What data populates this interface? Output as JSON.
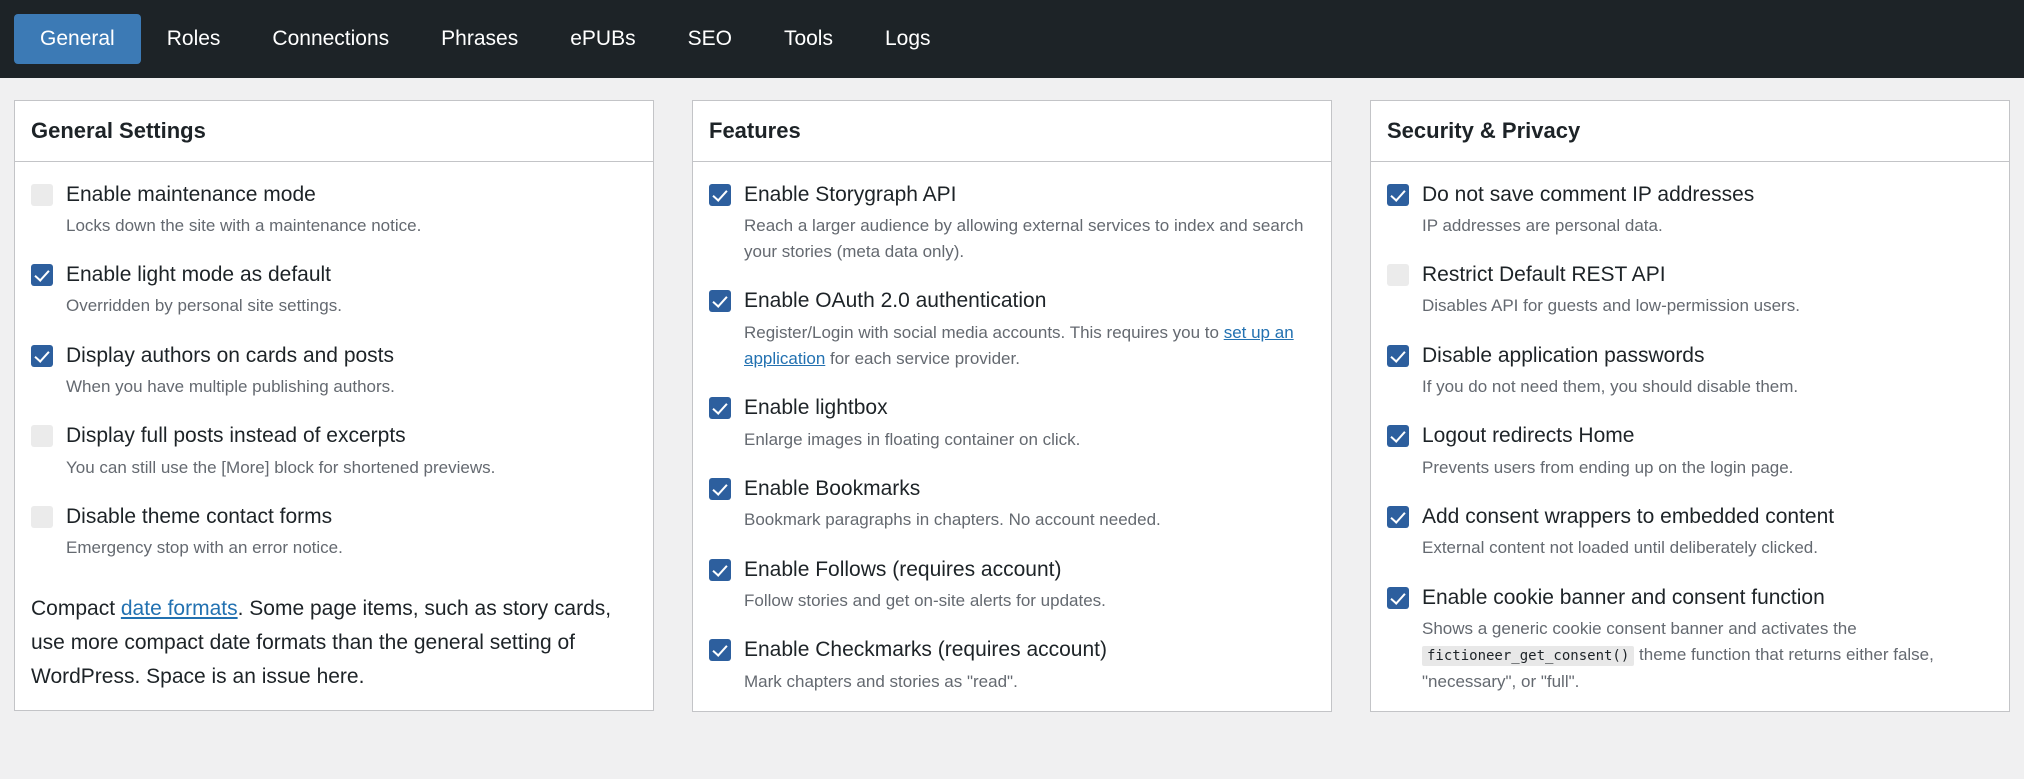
{
  "tabs": [
    {
      "label": "General",
      "active": true
    },
    {
      "label": "Roles",
      "active": false
    },
    {
      "label": "Connections",
      "active": false
    },
    {
      "label": "Phrases",
      "active": false
    },
    {
      "label": "ePUBs",
      "active": false
    },
    {
      "label": "SEO",
      "active": false
    },
    {
      "label": "Tools",
      "active": false
    },
    {
      "label": "Logs",
      "active": false
    }
  ],
  "colors": {
    "header_bg": "#1d2327",
    "active_tab_bg": "#3c7ab5",
    "page_bg": "#f0f0f1",
    "card_border": "#c3c4c7",
    "checkbox_checked": "#2d5f9e",
    "checkbox_unchecked": "#ebebeb",
    "link": "#2271b1",
    "description_text": "#646970"
  },
  "columns": [
    {
      "title": "General Settings",
      "items": [
        {
          "checked": false,
          "label": "Enable maintenance mode",
          "desc": "Locks down the site with a maintenance notice."
        },
        {
          "checked": true,
          "label": "Enable light mode as default",
          "desc": "Overridden by personal site settings."
        },
        {
          "checked": true,
          "label": "Display authors on cards and posts",
          "desc": "When you have multiple publishing authors."
        },
        {
          "checked": false,
          "label": "Display full posts instead of excerpts",
          "desc": "You can still use the [More] block for shortened previews."
        },
        {
          "checked": false,
          "label": "Disable theme contact forms",
          "desc": "Emergency stop with an error notice."
        }
      ],
      "note": {
        "before": "Compact ",
        "link": "date formats",
        "after": ". Some page items, such as story cards, use more compact date formats than the general setting of WordPress. Space is an issue here."
      }
    },
    {
      "title": "Features",
      "items": [
        {
          "checked": true,
          "label": "Enable Storygraph API",
          "desc": "Reach a larger audience by allowing external services to index and search your stories (meta data only)."
        },
        {
          "checked": true,
          "label": "Enable OAuth 2.0 authentication",
          "desc_before": "Register/Login with social media accounts. This requires you to ",
          "desc_link": "set up an application",
          "desc_after": " for each service provider."
        },
        {
          "checked": true,
          "label": "Enable lightbox",
          "desc": "Enlarge images in floating container on click."
        },
        {
          "checked": true,
          "label": "Enable Bookmarks",
          "desc": "Bookmark paragraphs in chapters. No account needed."
        },
        {
          "checked": true,
          "label": "Enable Follows (requires account)",
          "desc": "Follow stories and get on-site alerts for updates."
        },
        {
          "checked": true,
          "label": "Enable Checkmarks (requires account)",
          "desc": "Mark chapters and stories as \"read\"."
        }
      ]
    },
    {
      "title": "Security & Privacy",
      "items": [
        {
          "checked": true,
          "label": "Do not save comment IP addresses",
          "desc": "IP addresses are personal data."
        },
        {
          "checked": false,
          "label": "Restrict Default REST API",
          "desc": "Disables API for guests and low-permission users."
        },
        {
          "checked": true,
          "label": "Disable application passwords",
          "desc": "If you do not need them, you should disable them."
        },
        {
          "checked": true,
          "label": "Logout redirects Home",
          "desc": "Prevents users from ending up on the login page."
        },
        {
          "checked": true,
          "label": "Add consent wrappers to embedded content",
          "desc": "External content not loaded until deliberately clicked."
        },
        {
          "checked": true,
          "label": "Enable cookie banner and consent function",
          "desc_before": "Shows a generic cookie consent banner and activates the ",
          "desc_code": "fictioneer_get_consent()",
          "desc_after": " theme function that returns either false, \"necessary\", or \"full\"."
        }
      ]
    }
  ]
}
